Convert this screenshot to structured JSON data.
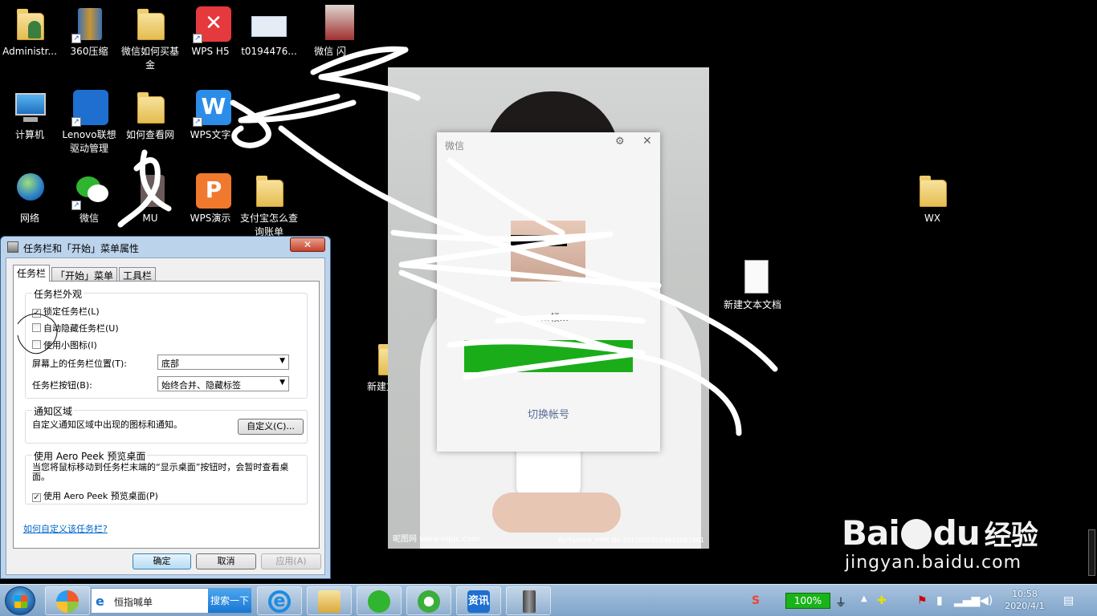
{
  "desktop": {
    "icons": [
      {
        "label": "Administr...",
        "icon": "user-folder-icon"
      },
      {
        "label": "360压缩",
        "icon": "zip-archive-icon"
      },
      {
        "label": "微信如何买基金",
        "icon": "folder-icon"
      },
      {
        "label": "WPS H5",
        "icon": "wps-h5-icon"
      },
      {
        "label": "t0194476...",
        "icon": "image-file-icon"
      },
      {
        "label": "微信 闪",
        "icon": "image-file-icon"
      },
      {
        "label": "计算机",
        "icon": "computer-icon"
      },
      {
        "label": "Lenovo联想驱动管理",
        "icon": "lenovo-driver-icon"
      },
      {
        "label": "如何查看网",
        "icon": "folder-icon"
      },
      {
        "label": "WPS文字",
        "icon": "wps-writer-icon"
      },
      {
        "label": "网络",
        "icon": "network-icon"
      },
      {
        "label": "微信",
        "icon": "wechat-icon"
      },
      {
        "label": "MU",
        "icon": "app-icon"
      },
      {
        "label": "WPS演示",
        "icon": "wps-presentation-icon"
      },
      {
        "label": "支付宝怎么查询账单",
        "icon": "folder-icon"
      },
      {
        "label": "新建文件夹",
        "icon": "folder-icon"
      },
      {
        "label": "新建文本文档",
        "icon": "text-document-icon"
      },
      {
        "label": "WX",
        "icon": "folder-icon"
      }
    ]
  },
  "photo": {
    "watermark_left": "昵图网 www.nipic.com",
    "watermark_right": "By:Yvonne_HMK No:20150707094834081881"
  },
  "wechat": {
    "title": "微信",
    "name": "... ...领...",
    "login_button": "",
    "switch_account": "切换帐号"
  },
  "dialog": {
    "title": "任务栏和「开始」菜单属性",
    "close": "✕",
    "tabs": [
      "任务栏",
      "「开始」菜单",
      "工具栏"
    ],
    "appearance": {
      "group": "任务栏外观",
      "lock": "锁定任务栏(L)",
      "lock_checked": true,
      "autohide": "自动隐藏任务栏(U)",
      "autohide_checked": false,
      "small_icons": "使用小图标(I)",
      "small_icons_checked": false,
      "position_label": "屏幕上的任务栏位置(T):",
      "position_value": "底部",
      "buttons_label": "任务栏按钮(B):",
      "buttons_value": "始终合并、隐藏标签"
    },
    "notify": {
      "group": "通知区域",
      "desc": "自定义通知区域中出现的图标和通知。",
      "customize": "自定义(C)..."
    },
    "aero": {
      "group": "使用 Aero Peek 预览桌面",
      "desc": "当您将鼠标移动到任务栏末端的“显示桌面”按钮时，会暂时查看桌面。",
      "checkbox": "使用 Aero Peek 预览桌面(P)",
      "checked": true
    },
    "help_link": "如何自定义该任务栏?",
    "ok": "确定",
    "cancel": "取消",
    "apply": "应用(A)"
  },
  "taskbar": {
    "search_text": "恒指喊单",
    "search_button": "搜索一下",
    "news_label": "资讯",
    "battery": "100%",
    "time": "10:58",
    "date": "2020/4/1"
  },
  "watermark": {
    "brand": "Bai",
    "brand2": "du",
    "jingyan": "经验",
    "url": "jingyan.baidu.com"
  }
}
